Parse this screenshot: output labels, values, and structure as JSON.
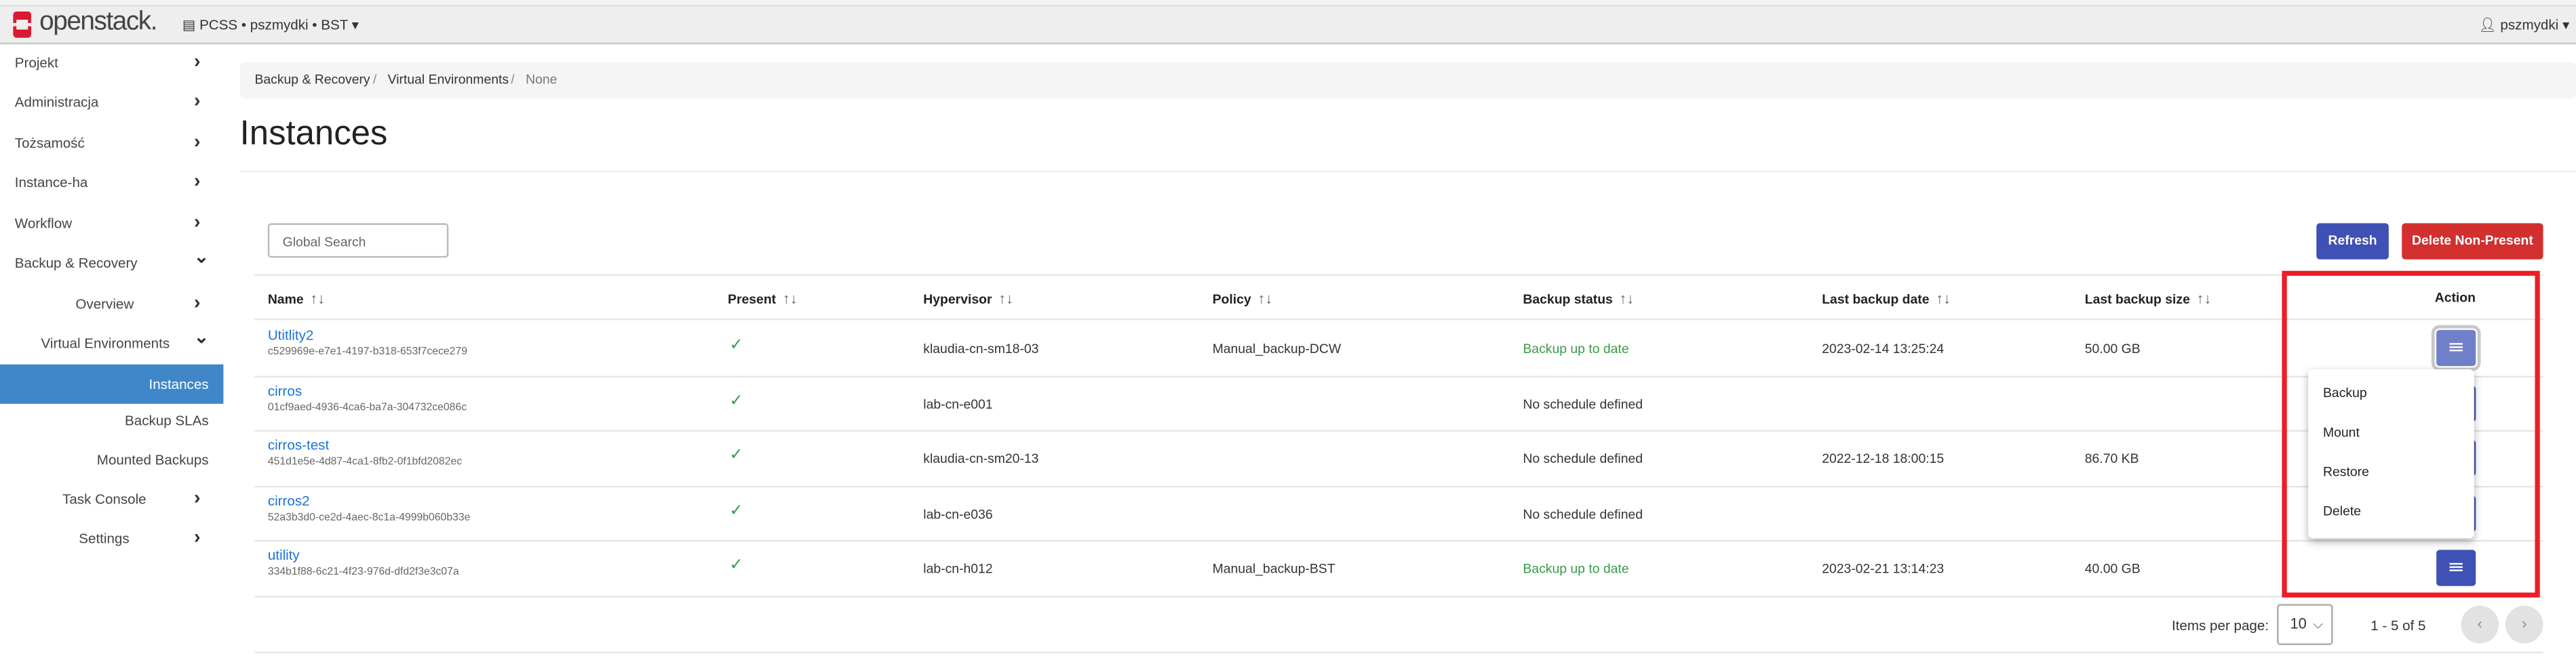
{
  "header": {
    "logo_text": "openstack.",
    "project_selector": "PCSS • pszmydki • BST",
    "user_menu": "pszmydki"
  },
  "sidebar": {
    "items": [
      {
        "label": "Projekt",
        "icon": "chevron-right"
      },
      {
        "label": "Administracja",
        "icon": "chevron-right"
      },
      {
        "label": "Tożsamość",
        "icon": "chevron-right"
      },
      {
        "label": "Instance-ha",
        "icon": "chevron-right"
      },
      {
        "label": "Workflow",
        "icon": "chevron-right"
      },
      {
        "label": "Backup & Recovery",
        "icon": "chevron-down"
      },
      {
        "label": "Overview",
        "icon": "chevron-right"
      },
      {
        "label": "Virtual Environments",
        "icon": "chevron-down"
      },
      {
        "label": "Instances",
        "active": true
      },
      {
        "label": "Backup SLAs"
      },
      {
        "label": "Mounted Backups"
      },
      {
        "label": "Task Console",
        "icon": "chevron-right"
      },
      {
        "label": "Settings",
        "icon": "chevron-right"
      }
    ]
  },
  "breadcrumb": [
    "Backup & Recovery",
    "Virtual Environments",
    "None"
  ],
  "page_title": "Instances",
  "toolbar": {
    "search_placeholder": "Global Search",
    "refresh_label": "Refresh",
    "delete_label": "Delete Non-Present"
  },
  "colors": {
    "primary": "#3f51b5",
    "danger": "#d32f2f",
    "active_nav": "#3f87c8",
    "success": "#3a9a48",
    "highlight_box": "#ee1c25"
  },
  "table": {
    "columns": [
      "Name",
      "Present",
      "Hypervisor",
      "Policy",
      "Backup status",
      "Last backup date",
      "Last backup size",
      "Action"
    ],
    "rows": [
      {
        "name": "Utitlity2",
        "id": "c529969e-e7e1-4197-b318-653f7cece279",
        "present": "✓",
        "hypervisor": "klaudia-cn-sm18-03",
        "policy": "Manual_backup-DCW",
        "status": "Backup up to date",
        "status_ok": true,
        "date": "2023-02-14 13:25:24",
        "size": "50.00 GB"
      },
      {
        "name": "cirros",
        "id": "01cf9aed-4936-4ca6-ba7a-304732ce086c",
        "present": "✓",
        "hypervisor": "lab-cn-e001",
        "policy": "",
        "status": "No schedule defined",
        "status_ok": false,
        "date": "",
        "size": ""
      },
      {
        "name": "cirros-test",
        "id": "451d1e5e-4d87-4ca1-8fb2-0f1bfd2082ec",
        "present": "✓",
        "hypervisor": "klaudia-cn-sm20-13",
        "policy": "",
        "status": "No schedule defined",
        "status_ok": false,
        "date": "2022-12-18 18:00:15",
        "size": "86.70 KB"
      },
      {
        "name": "cirros2",
        "id": "52a3b3d0-ce2d-4aec-8c1a-4999b060b33e",
        "present": "✓",
        "hypervisor": "lab-cn-e036",
        "policy": "",
        "status": "No schedule defined",
        "status_ok": false,
        "date": "",
        "size": ""
      },
      {
        "name": "utility",
        "id": "334b1f88-6c21-4f23-976d-dfd2f3e3c07a",
        "present": "✓",
        "hypervisor": "lab-cn-h012",
        "policy": "Manual_backup-BST",
        "status": "Backup up to date",
        "status_ok": true,
        "date": "2023-02-21 13:14:23",
        "size": "40.00 GB"
      }
    ]
  },
  "action_menu": {
    "items": [
      "Backup",
      "Mount",
      "Restore",
      "Delete"
    ]
  },
  "pagination": {
    "items_per_page_label": "Items per page:",
    "items_per_page": "10",
    "range": "1 - 5 of 5"
  }
}
